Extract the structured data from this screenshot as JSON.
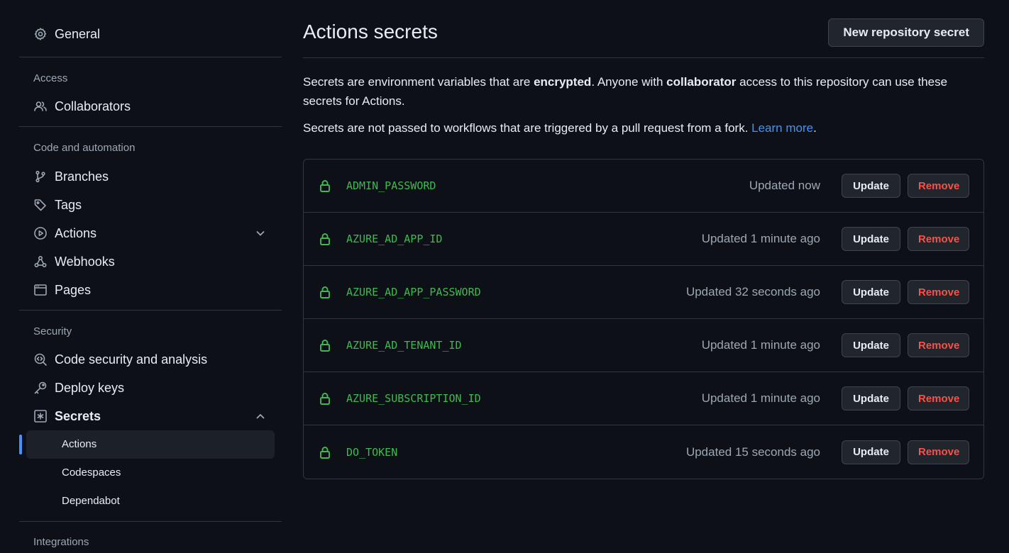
{
  "sidebar": {
    "general": "General",
    "access_label": "Access",
    "collaborators": "Collaborators",
    "code_label": "Code and automation",
    "branches": "Branches",
    "tags": "Tags",
    "actions": "Actions",
    "webhooks": "Webhooks",
    "pages": "Pages",
    "security_label": "Security",
    "code_security": "Code security and analysis",
    "deploy_keys": "Deploy keys",
    "secrets": "Secrets",
    "secrets_sub": [
      "Actions",
      "Codespaces",
      "Dependabot"
    ],
    "integrations_label": "Integrations"
  },
  "main": {
    "title": "Actions secrets",
    "new_button": "New repository secret",
    "desc_1": "Secrets are environment variables that are ",
    "desc_bold_1": "encrypted",
    "desc_2": ". Anyone with ",
    "desc_bold_2": "collaborator",
    "desc_3": " access to this repository can use these secrets for Actions.",
    "desc_line2": "Secrets are not passed to workflows that are triggered by a pull request from a fork. ",
    "learn_more": "Learn more",
    "period": "."
  },
  "buttons": {
    "update": "Update",
    "remove": "Remove"
  },
  "secrets": [
    {
      "name": "ADMIN_PASSWORD",
      "updated": "Updated now"
    },
    {
      "name": "AZURE_AD_APP_ID",
      "updated": "Updated 1 minute ago"
    },
    {
      "name": "AZURE_AD_APP_PASSWORD",
      "updated": "Updated 32 seconds ago"
    },
    {
      "name": "AZURE_AD_TENANT_ID",
      "updated": "Updated 1 minute ago"
    },
    {
      "name": "AZURE_SUBSCRIPTION_ID",
      "updated": "Updated 1 minute ago"
    },
    {
      "name": "DO_TOKEN",
      "updated": "Updated 15 seconds ago"
    }
  ],
  "colors": {
    "accent": "#4493f8",
    "green": "#3fb950",
    "danger": "#f85149",
    "bg": "#0d1117"
  }
}
